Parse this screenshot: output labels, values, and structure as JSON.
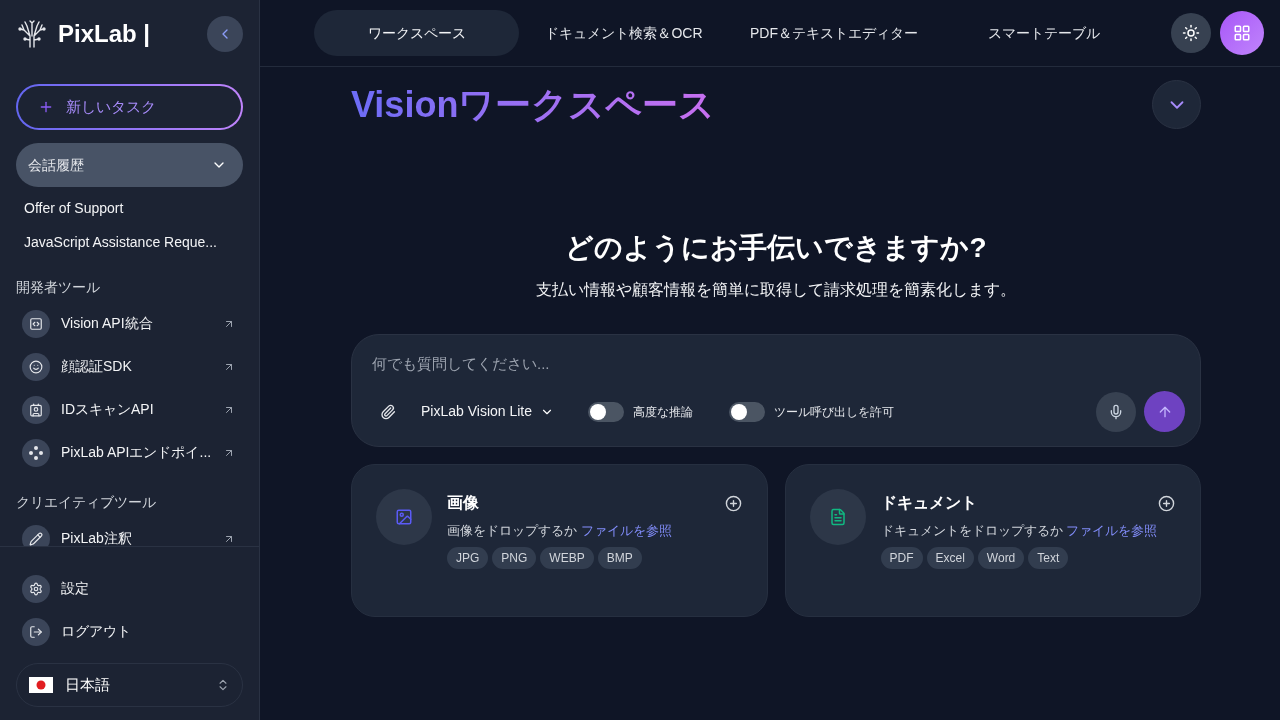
{
  "sidebar": {
    "logo": "PixLab |",
    "new_task": "新しいタスク",
    "history": {
      "label": "会話履歴",
      "items": [
        "Offer of Support",
        "JavaScript Assistance Reque..."
      ]
    },
    "sections": [
      {
        "title": "開発者ツール",
        "items": [
          "Vision API統合",
          "顔認証SDK",
          "IDスキャンAPI",
          "PixLab APIエンドポイ..."
        ]
      },
      {
        "title": "クリエイティブツール",
        "items": [
          "PixLab注釈"
        ]
      }
    ],
    "footer": [
      "設定",
      "ログアウト"
    ],
    "language": "日本語"
  },
  "tabs": [
    {
      "label": "ワークスペース",
      "selected": true
    },
    {
      "label": "ドキュメント検索＆OCR",
      "selected": false
    },
    {
      "label": "PDF＆テキストエディター",
      "selected": false
    },
    {
      "label": "スマートテーブル",
      "selected": false
    }
  ],
  "workspace": {
    "title": "Visionワークスペース",
    "heading": "どのようにお手伝いできますか?",
    "subtitle": "支払い情報や顧客情報を簡単に取得して請求処理を簡素化します。"
  },
  "composer": {
    "placeholder": "何でも質問してください...",
    "model": "PixLab Vision Lite",
    "toggles": [
      {
        "label": "高度な推論",
        "on": false
      },
      {
        "label": "ツール呼び出しを許可",
        "on": false
      }
    ]
  },
  "upload_cards": [
    {
      "title": "画像",
      "text": "画像をドロップするか",
      "link": "ファイルを参照",
      "formats": [
        "JPG",
        "PNG",
        "WEBP",
        "BMP"
      ]
    },
    {
      "title": "ドキュメント",
      "text": "ドキュメントをドロップするか",
      "link": "ファイルを参照",
      "formats": [
        "PDF",
        "Excel",
        "Word",
        "Text"
      ]
    }
  ]
}
